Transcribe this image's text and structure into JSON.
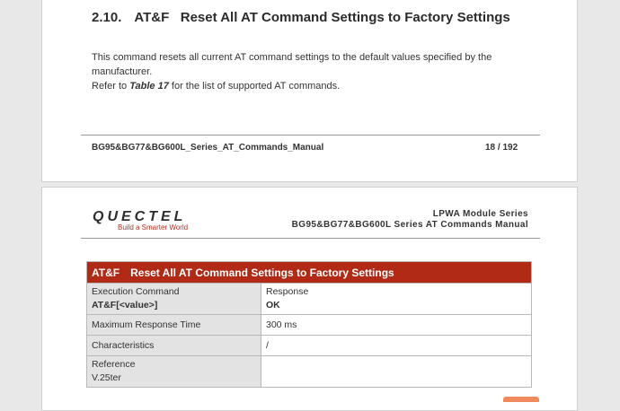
{
  "page1": {
    "section_number": "2.10.",
    "section_title": "AT&F   Reset All AT Command Settings to Factory Settings",
    "body_line1": "This command resets all current AT command settings to the default values specified by the manufacturer.",
    "body_prefix": "Refer to",
    "body_ref": "Table 17",
    "body_suffix": "for the list of supported AT commands.",
    "footer_doc": "BG95&BG77&BG600L_Series_AT_Commands_Manual",
    "footer_page": "18 / 192"
  },
  "page2": {
    "logo_text": "QUECTEL",
    "logo_tagline": "Build a Smarter World",
    "header_line1": "LPWA Module Series",
    "header_line2": "BG95&BG77&BG600L Series AT Commands Manual",
    "table": {
      "command": "AT&F",
      "title": "Reset All AT Command Settings to Factory Settings",
      "rows": [
        {
          "label": "Execution Command",
          "label_sub": "AT&F[<value>]",
          "value": "Response",
          "value_sub": "OK"
        },
        {
          "label": "Maximum Response Time",
          "value": "300 ms"
        },
        {
          "label": "Characteristics",
          "value": "/"
        },
        {
          "label": "Reference",
          "label_sub": "V.25ter",
          "value": ""
        }
      ]
    }
  },
  "colors": {
    "table_header": "#b02a16",
    "label_cell": "#e3e3e3",
    "brand_red": "#c42a1c"
  }
}
